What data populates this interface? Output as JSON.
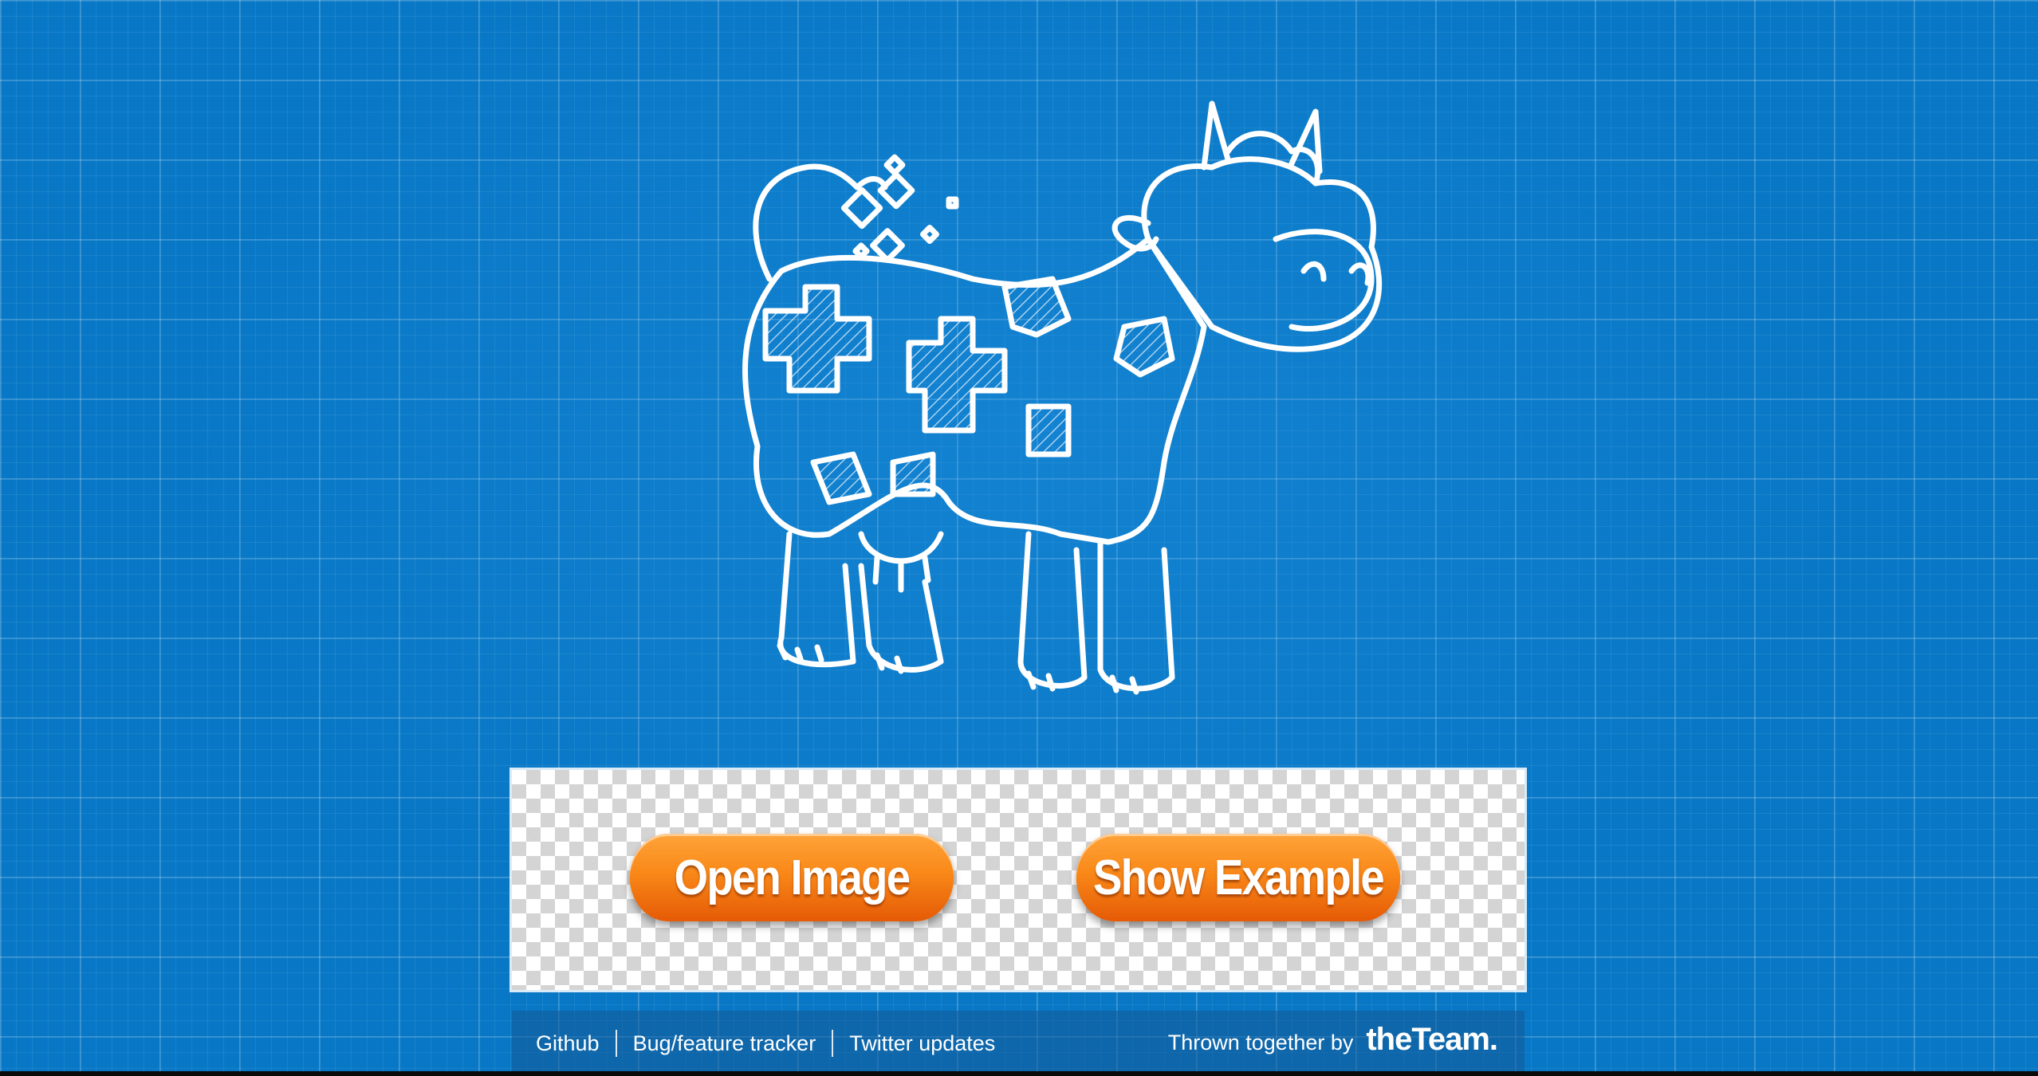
{
  "actions": {
    "open_image": "Open Image",
    "show_example": "Show Example"
  },
  "footer": {
    "links": [
      "Github",
      "Bug/feature tracker",
      "Twitter updates"
    ],
    "credit_label": "Thrown together by",
    "brand": "theTeam."
  },
  "colors": {
    "background": "#0878c6",
    "button": "#f98818",
    "outline": "#ffffff"
  },
  "icons": {
    "mascot": "cow-mascot-icon"
  }
}
